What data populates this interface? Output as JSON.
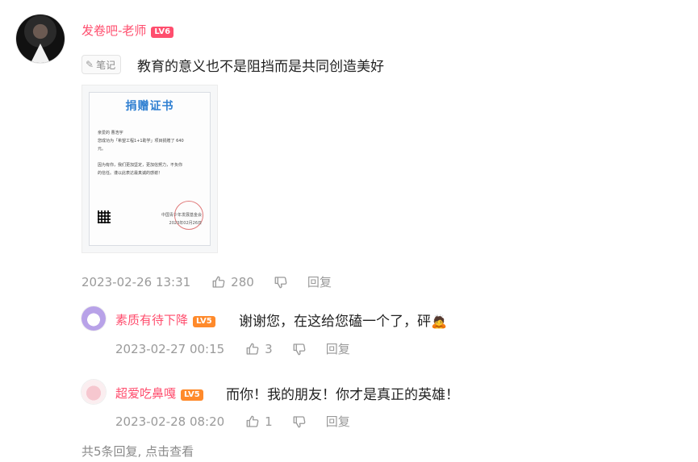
{
  "main_comment": {
    "author": "发卷吧-老师",
    "level": "LV6",
    "note_tag": "笔记",
    "text": "教育的意义也不是阻挡而是共同创造美好",
    "time": "2023-02-26 13:31",
    "likes": "280",
    "reply_label": "回复",
    "certificate": {
      "title": "捐赠证书",
      "line1": "亲爱的 曹浩宇",
      "line2": "您成功为「希望工程1+1助学」项目捐赠了 640",
      "line3": "元。",
      "line4": "因为有你，我们更加坚定，更加信努力，不负你",
      "line5": "的信任。谨以此表达最真诚的感谢！",
      "org": "中国青少年发展基金会",
      "date": "2023年02月26日"
    }
  },
  "replies": [
    {
      "author": "素质有待下降",
      "level": "LV5",
      "text": "谢谢您，在这给您磕一个了，砰",
      "emoji": "🙇",
      "time": "2023-02-27 00:15",
      "likes": "3",
      "reply_label": "回复"
    },
    {
      "author": "超爱吃鼻嘎",
      "level": "LV5",
      "text": "而你！我的朋友！你才是真正的英雄！",
      "time": "2023-02-28 08:20",
      "likes": "1",
      "reply_label": "回复"
    }
  ],
  "more_replies": "共5条回复, 点击查看",
  "colors": {
    "username": "#ff4e6e",
    "level_lv6": "#ff4e6e",
    "level_lv5": "#ff8a2b",
    "meta": "#9a9a9a"
  }
}
